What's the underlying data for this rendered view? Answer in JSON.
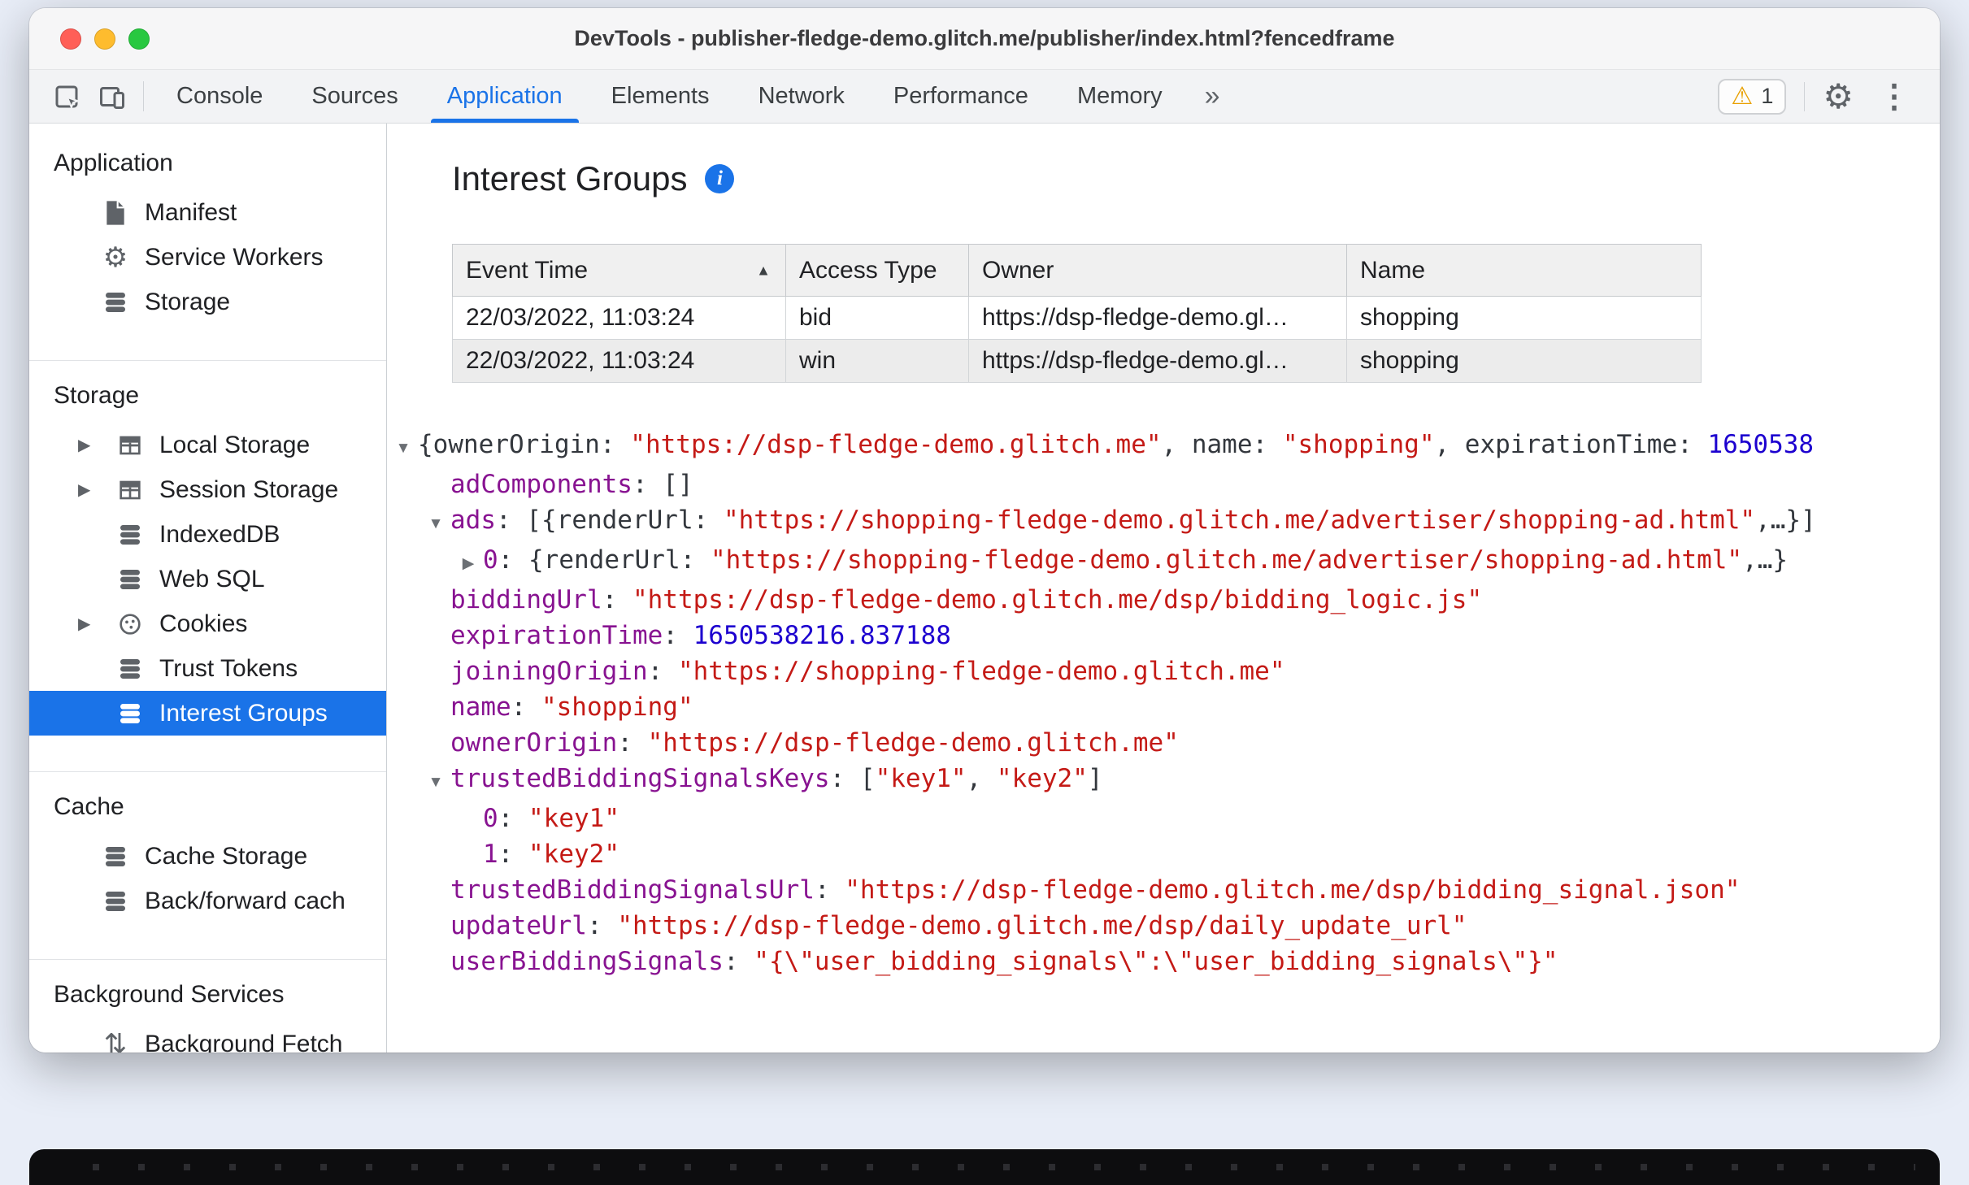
{
  "window": {
    "title": "DevTools - publisher-fledge-demo.glitch.me/publisher/index.html?fencedframe"
  },
  "glyphs": {
    "warning": "⚠",
    "gear": "⚙",
    "kebab": "⋮",
    "info": "i",
    "more_tabs": "»",
    "sort_asc": "▲",
    "expander": "▶",
    "collapse": "▼",
    "expand": "▶",
    "bg_fetch": "⇅"
  },
  "toolbar": {
    "tabs": [
      {
        "label": "Console"
      },
      {
        "label": "Sources"
      },
      {
        "label": "Application",
        "active": true
      },
      {
        "label": "Elements"
      },
      {
        "label": "Network"
      },
      {
        "label": "Performance"
      },
      {
        "label": "Memory"
      }
    ],
    "warning_count": "1"
  },
  "sidebar": {
    "sections": [
      {
        "title": "Application",
        "items": [
          {
            "label": "Manifest",
            "icon": "document-icon"
          },
          {
            "label": "Service Workers",
            "icon": "gear-icon"
          },
          {
            "label": "Storage",
            "icon": "database-icon"
          }
        ]
      },
      {
        "title": "Storage",
        "items": [
          {
            "label": "Local Storage",
            "icon": "table-icon",
            "expandable": true
          },
          {
            "label": "Session Storage",
            "icon": "table-icon",
            "expandable": true
          },
          {
            "label": "IndexedDB",
            "icon": "database-icon"
          },
          {
            "label": "Web SQL",
            "icon": "database-icon"
          },
          {
            "label": "Cookies",
            "icon": "cookie-icon",
            "expandable": true
          },
          {
            "label": "Trust Tokens",
            "icon": "database-icon"
          },
          {
            "label": "Interest Groups",
            "icon": "database-icon",
            "selected": true
          }
        ]
      },
      {
        "title": "Cache",
        "items": [
          {
            "label": "Cache Storage",
            "icon": "database-icon"
          },
          {
            "label": "Back/forward cach",
            "icon": "database-icon"
          }
        ]
      },
      {
        "title": "Background Services",
        "items": [
          {
            "label": "Background Fetch",
            "icon": "up-down-arrows-icon"
          }
        ]
      }
    ]
  },
  "main": {
    "heading": "Interest Groups",
    "table": {
      "columns": [
        "Event Time",
        "Access Type",
        "Owner",
        "Name"
      ],
      "sort_column": "Event Time",
      "sort_direction": "ascending",
      "rows": [
        [
          "22/03/2022, 11:03:24",
          "bid",
          "https://dsp-fledge-demo.gl…",
          "shopping"
        ],
        [
          "22/03/2022, 11:03:24",
          "win",
          "https://dsp-fledge-demo.gl…",
          "shopping"
        ]
      ]
    },
    "tree": {
      "lines": [
        {
          "lvl": 0,
          "arrow": "d",
          "parts": [
            {
              "c": "p",
              "t": "{ownerOrigin: "
            },
            {
              "c": "s",
              "t": "\"https://dsp-fledge-demo.glitch.me\""
            },
            {
              "c": "p",
              "t": ", name: "
            },
            {
              "c": "s",
              "t": "\"shopping\""
            },
            {
              "c": "p",
              "t": ", expirationTime: "
            },
            {
              "c": "n",
              "t": "1650538"
            }
          ]
        },
        {
          "lvl": 1,
          "arrow": null,
          "parts": [
            {
              "c": "k",
              "t": "adComponents"
            },
            {
              "c": "p",
              "t": ": []"
            }
          ]
        },
        {
          "lvl": 1,
          "arrow": "d",
          "parts": [
            {
              "c": "k",
              "t": "ads"
            },
            {
              "c": "p",
              "t": ": [{renderUrl: "
            },
            {
              "c": "s",
              "t": "\"https://shopping-fledge-demo.glitch.me/advertiser/shopping-ad.html\""
            },
            {
              "c": "p",
              "t": ",…}]"
            }
          ]
        },
        {
          "lvl": 2,
          "arrow": "r",
          "parts": [
            {
              "c": "k",
              "t": "0"
            },
            {
              "c": "p",
              "t": ": {renderUrl: "
            },
            {
              "c": "s",
              "t": "\"https://shopping-fledge-demo.glitch.me/advertiser/shopping-ad.html\""
            },
            {
              "c": "p",
              "t": ",…}"
            }
          ]
        },
        {
          "lvl": 1,
          "arrow": null,
          "parts": [
            {
              "c": "k",
              "t": "biddingUrl"
            },
            {
              "c": "p",
              "t": ": "
            },
            {
              "c": "s",
              "t": "\"https://dsp-fledge-demo.glitch.me/dsp/bidding_logic.js\""
            }
          ]
        },
        {
          "lvl": 1,
          "arrow": null,
          "parts": [
            {
              "c": "k",
              "t": "expirationTime"
            },
            {
              "c": "p",
              "t": ": "
            },
            {
              "c": "n",
              "t": "1650538216.837188"
            }
          ]
        },
        {
          "lvl": 1,
          "arrow": null,
          "parts": [
            {
              "c": "k",
              "t": "joiningOrigin"
            },
            {
              "c": "p",
              "t": ": "
            },
            {
              "c": "s",
              "t": "\"https://shopping-fledge-demo.glitch.me\""
            }
          ]
        },
        {
          "lvl": 1,
          "arrow": null,
          "parts": [
            {
              "c": "k",
              "t": "name"
            },
            {
              "c": "p",
              "t": ": "
            },
            {
              "c": "s",
              "t": "\"shopping\""
            }
          ]
        },
        {
          "lvl": 1,
          "arrow": null,
          "parts": [
            {
              "c": "k",
              "t": "ownerOrigin"
            },
            {
              "c": "p",
              "t": ": "
            },
            {
              "c": "s",
              "t": "\"https://dsp-fledge-demo.glitch.me\""
            }
          ]
        },
        {
          "lvl": 1,
          "arrow": "d",
          "parts": [
            {
              "c": "k",
              "t": "trustedBiddingSignalsKeys"
            },
            {
              "c": "p",
              "t": ": ["
            },
            {
              "c": "s",
              "t": "\"key1\""
            },
            {
              "c": "p",
              "t": ", "
            },
            {
              "c": "s",
              "t": "\"key2\""
            },
            {
              "c": "p",
              "t": "]"
            }
          ]
        },
        {
          "lvl": 2,
          "arrow": null,
          "parts": [
            {
              "c": "k",
              "t": "0"
            },
            {
              "c": "p",
              "t": ": "
            },
            {
              "c": "s",
              "t": "\"key1\""
            }
          ]
        },
        {
          "lvl": 2,
          "arrow": null,
          "parts": [
            {
              "c": "k",
              "t": "1"
            },
            {
              "c": "p",
              "t": ": "
            },
            {
              "c": "s",
              "t": "\"key2\""
            }
          ]
        },
        {
          "lvl": 1,
          "arrow": null,
          "parts": [
            {
              "c": "k",
              "t": "trustedBiddingSignalsUrl"
            },
            {
              "c": "p",
              "t": ": "
            },
            {
              "c": "s",
              "t": "\"https://dsp-fledge-demo.glitch.me/dsp/bidding_signal.json\""
            }
          ]
        },
        {
          "lvl": 1,
          "arrow": null,
          "parts": [
            {
              "c": "k",
              "t": "updateUrl"
            },
            {
              "c": "p",
              "t": ": "
            },
            {
              "c": "s",
              "t": "\"https://dsp-fledge-demo.glitch.me/dsp/daily_update_url\""
            }
          ]
        },
        {
          "lvl": 1,
          "arrow": null,
          "parts": [
            {
              "c": "k",
              "t": "userBiddingSignals"
            },
            {
              "c": "p",
              "t": ": "
            },
            {
              "c": "s",
              "t": "\"{\\\"user_bidding_signals\\\":\\\"user_bidding_signals\\\"}\""
            }
          ]
        }
      ]
    }
  }
}
